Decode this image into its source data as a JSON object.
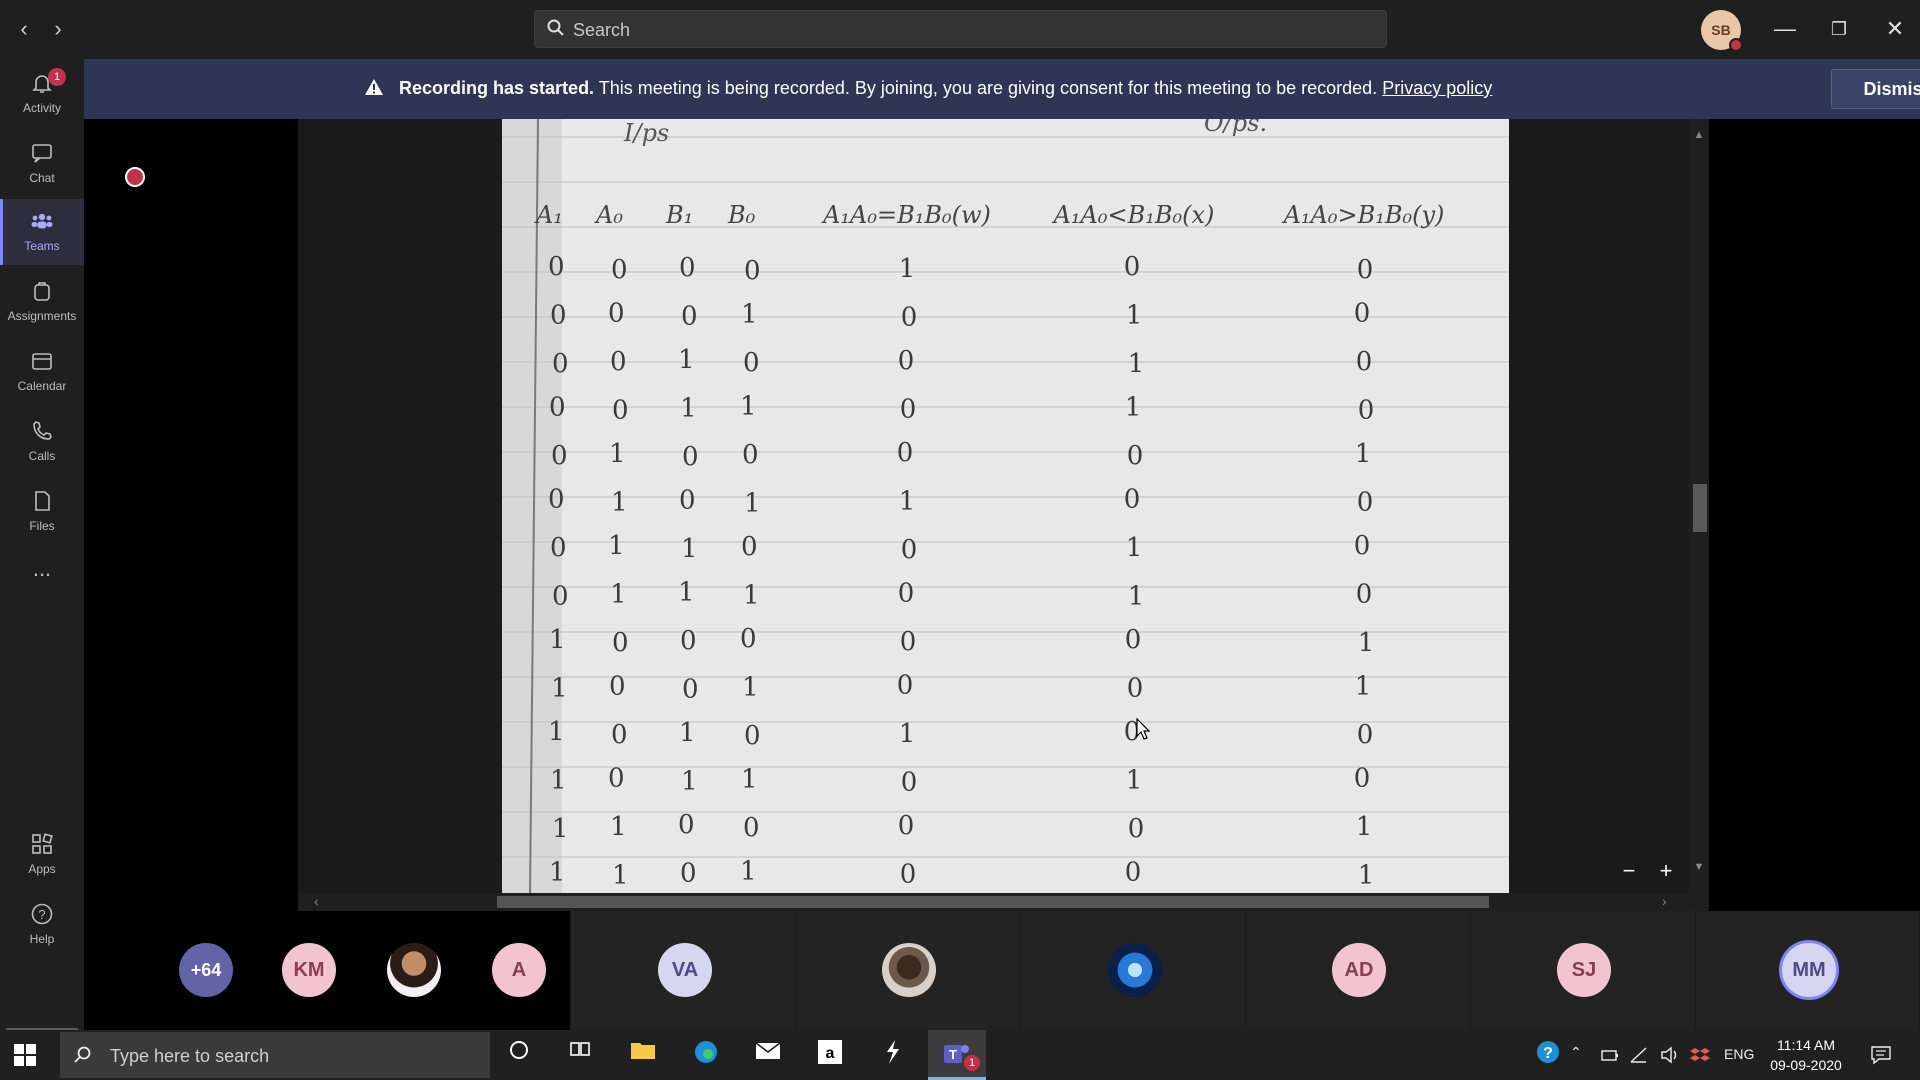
{
  "titlebar": {
    "search_placeholder": "Search",
    "user_initials": "SB"
  },
  "rail": {
    "items": [
      {
        "label": "Activity",
        "badge": "1"
      },
      {
        "label": "Chat"
      },
      {
        "label": "Teams"
      },
      {
        "label": "Assignments"
      },
      {
        "label": "Calendar"
      },
      {
        "label": "Calls"
      },
      {
        "label": "Files"
      },
      {
        "label": "..."
      }
    ],
    "bottom": [
      {
        "label": "Apps"
      },
      {
        "label": "Help"
      }
    ]
  },
  "banner": {
    "title": "Recording has started.",
    "message": "This meeting is being recorded. By joining, you are giving consent for this meeting to be recorded.",
    "link": "Privacy policy",
    "dismiss": "Dismiss"
  },
  "shared_content": {
    "heading_left": "I/ps",
    "heading_right": "O/ps.",
    "columns": [
      "A₁",
      "A₀",
      "B₁",
      "B₀",
      "A₁A₀=B₁B₀(w)",
      "A₁A₀<B₁B₀(x)",
      "A₁A₀>B₁B₀(y)"
    ],
    "rows": [
      [
        "0",
        "0",
        "0",
        "0",
        "1",
        "0",
        "0"
      ],
      [
        "0",
        "0",
        "0",
        "1",
        "0",
        "1",
        "0"
      ],
      [
        "0",
        "0",
        "1",
        "0",
        "0",
        "1",
        "0"
      ],
      [
        "0",
        "0",
        "1",
        "1",
        "0",
        "1",
        "0"
      ],
      [
        "0",
        "1",
        "0",
        "0",
        "0",
        "0",
        "1"
      ],
      [
        "0",
        "1",
        "0",
        "1",
        "1",
        "0",
        "0"
      ],
      [
        "0",
        "1",
        "1",
        "0",
        "0",
        "1",
        "0"
      ],
      [
        "0",
        "1",
        "1",
        "1",
        "0",
        "1",
        "0"
      ],
      [
        "1",
        "0",
        "0",
        "0",
        "0",
        "0",
        "1"
      ],
      [
        "1",
        "0",
        "0",
        "1",
        "0",
        "0",
        "1"
      ],
      [
        "1",
        "0",
        "1",
        "0",
        "1",
        "0",
        "0"
      ],
      [
        "1",
        "0",
        "1",
        "1",
        "0",
        "1",
        "0"
      ],
      [
        "1",
        "1",
        "0",
        "0",
        "0",
        "0",
        "1"
      ],
      [
        "1",
        "1",
        "0",
        "1",
        "0",
        "0",
        "1"
      ]
    ],
    "zoom_out": "−",
    "zoom_in": "+"
  },
  "participants": [
    {
      "label": "+64",
      "style": "purple"
    },
    {
      "label": "KM",
      "style": "pink"
    },
    {
      "label": "",
      "style": "photo1"
    },
    {
      "label": "A",
      "style": "pink"
    },
    {
      "label": "VA",
      "style": "lav"
    },
    {
      "label": "",
      "style": "photo2"
    },
    {
      "label": "",
      "style": "photo3"
    },
    {
      "label": "AD",
      "style": "pink"
    },
    {
      "label": "SJ",
      "style": "pink"
    },
    {
      "label": "MM",
      "style": "lav"
    }
  ],
  "taskbar": {
    "search_placeholder": "Type here to search",
    "teams_badge": "1",
    "language": "ENG",
    "time": "11:14 AM",
    "date": "09-09-2020"
  },
  "colors": {
    "banner_bg": "#2e3555",
    "accent": "#7f85f5",
    "alert": "#c4314b"
  }
}
